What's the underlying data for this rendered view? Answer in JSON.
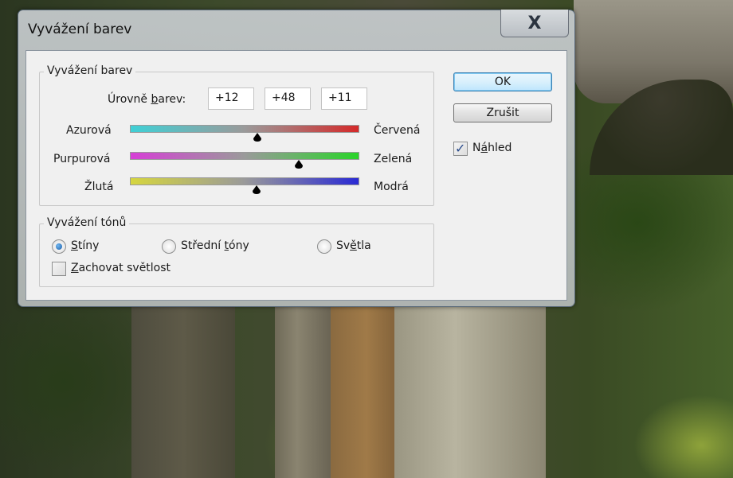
{
  "window": {
    "title": "Vyvážení barev",
    "close_glyph": "X"
  },
  "color_balance": {
    "group_label": "Vyvážení barev",
    "levels_label_pre": "Úrovně ",
    "levels_label_mnemonic": "b",
    "levels_label_post": "arev:",
    "levels": [
      "+12",
      "+48",
      "+11"
    ],
    "sliders": [
      {
        "left_label": "Azurová",
        "right_label": "Červená",
        "value": 12,
        "min": -100,
        "max": 100,
        "color_left": "#3fd0d6",
        "color_right": "#d42a2a"
      },
      {
        "left_label": "Purpurová",
        "right_label": "Zelená",
        "value": 48,
        "min": -100,
        "max": 100,
        "color_left": "#d63fd6",
        "color_right": "#2ad42a"
      },
      {
        "left_label": "Žlutá",
        "right_label": "Modrá",
        "value": 11,
        "min": -100,
        "max": 100,
        "color_left": "#d6d63f",
        "color_right": "#2a2ad4"
      }
    ]
  },
  "tone_balance": {
    "group_label": "Vyvážení tónů",
    "options": [
      {
        "pre": "",
        "mnemonic": "S",
        "post": "tíny",
        "selected": true
      },
      {
        "pre": "Střední ",
        "mnemonic": "t",
        "post": "óny",
        "selected": false
      },
      {
        "pre": "Sv",
        "mnemonic": "ě",
        "post": "tla",
        "selected": false
      }
    ],
    "preserve_luminosity": {
      "pre": "",
      "mnemonic": "Z",
      "post": "achovat světlost",
      "checked": false
    }
  },
  "buttons": {
    "ok": "OK",
    "cancel": "Zrušit"
  },
  "preview": {
    "pre": "N",
    "mnemonic": "á",
    "post": "hled",
    "checked": true
  }
}
